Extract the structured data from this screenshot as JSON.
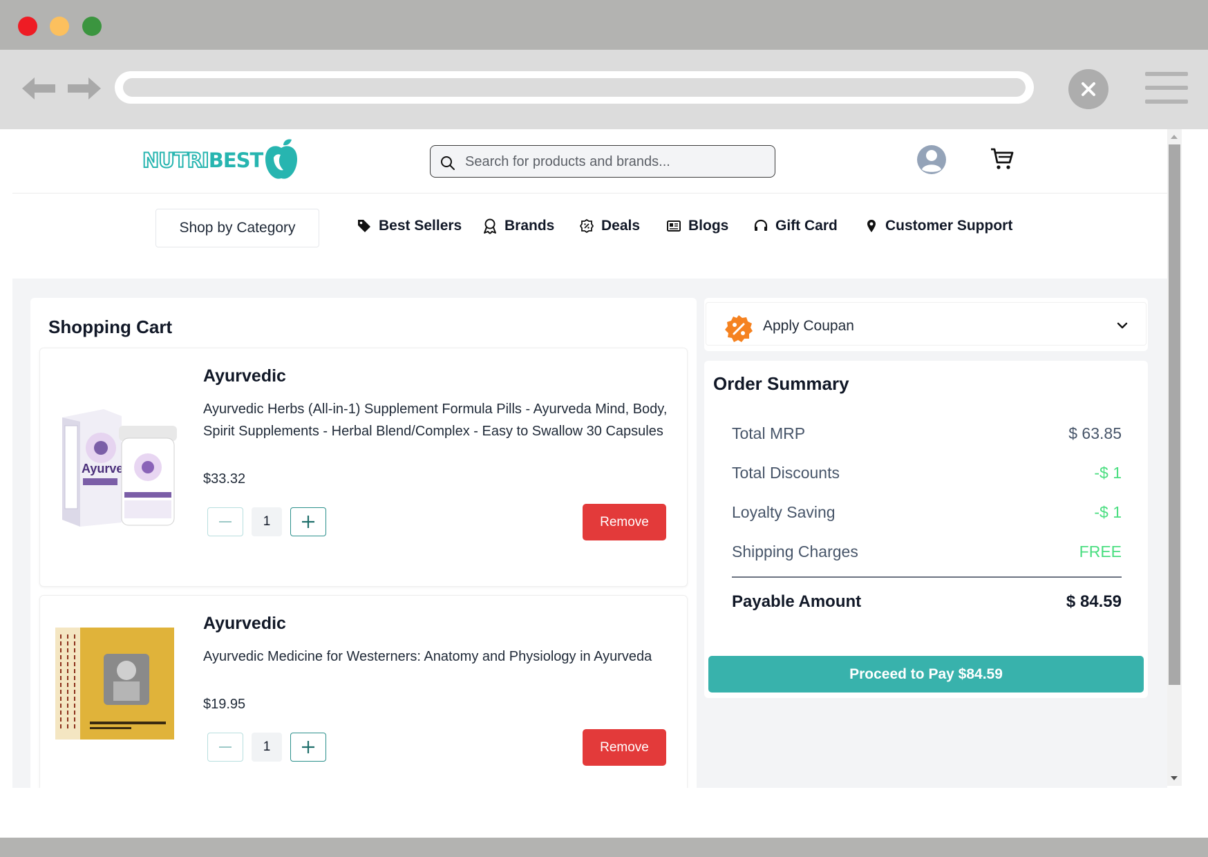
{
  "site": {
    "logo_part1": "NUTRI",
    "logo_part2": "BEST",
    "brand_color": "#27b5b0"
  },
  "search": {
    "placeholder": "Search for products and brands..."
  },
  "nav": {
    "shop_by_category": "Shop by Category",
    "items": [
      {
        "label": "Best Sellers",
        "icon": "tag-icon"
      },
      {
        "label": "Brands",
        "icon": "award-icon"
      },
      {
        "label": "Deals",
        "icon": "badge-percent-icon"
      },
      {
        "label": "Blogs",
        "icon": "newspaper-icon"
      },
      {
        "label": "Gift Card",
        "icon": "headphones-icon"
      },
      {
        "label": "Customer Support",
        "icon": "map-pin-icon"
      }
    ]
  },
  "cart": {
    "title": "Shopping Cart",
    "items": [
      {
        "category": "Ayurvedic",
        "description": "Ayurvedic Herbs (All-in-1) Supplement Formula Pills - Ayurveda Mind, Body, Spirit Supplements - Herbal Blend/Complex - Easy to Swallow 30 Capsules",
        "price": "$33.32",
        "quantity": "1",
        "remove_label": "Remove",
        "image_label": "Ayurvedic"
      },
      {
        "category": "Ayurvedic",
        "description": "Ayurvedic Medicine for Westerners: Anatomy and Physiology in Ayurveda",
        "price": "$19.95",
        "quantity": "1",
        "remove_label": "Remove"
      }
    ]
  },
  "coupon": {
    "label": "Apply Coupan"
  },
  "summary": {
    "title": "Order Summary",
    "rows": [
      {
        "label": "Total MRP",
        "value": "$ 63.85"
      },
      {
        "label": "Total Discounts",
        "value": "-$ 1"
      },
      {
        "label": "Loyalty Saving",
        "value": "-$ 1"
      },
      {
        "label": "Shipping Charges",
        "value": "FREE"
      }
    ],
    "payable_label": "Payable Amount",
    "payable_value": "$ 84.59",
    "pay_button": "Proceed to Pay $84.59"
  },
  "colors": {
    "accent": "#38b2ac",
    "danger": "#e33a3a",
    "discount": "#4ade80"
  }
}
